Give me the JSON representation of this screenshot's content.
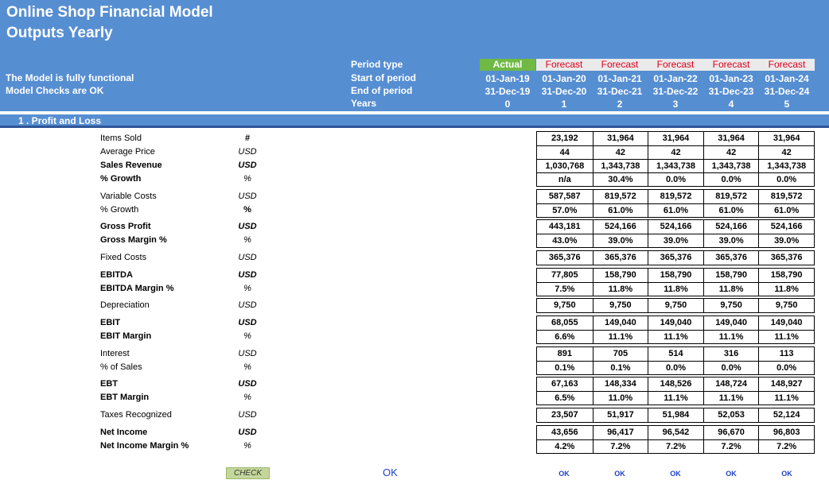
{
  "header": {
    "title_line1": "Online Shop Financial Model",
    "title_line2": "Outputs Yearly",
    "status_functional": "The Model is fully functional",
    "status_checks": "Model Checks are OK",
    "label_period_type": "Period type",
    "label_start": "Start of period",
    "label_end": "End of period",
    "label_years": "Years"
  },
  "columns": [
    {
      "type": "Actual",
      "start": "01-Jan-19",
      "end": "31-Dec-19",
      "year": "0"
    },
    {
      "type": "Forecast",
      "start": "01-Jan-20",
      "end": "31-Dec-20",
      "year": "1"
    },
    {
      "type": "Forecast",
      "start": "01-Jan-21",
      "end": "31-Dec-21",
      "year": "2"
    },
    {
      "type": "Forecast",
      "start": "01-Jan-22",
      "end": "31-Dec-22",
      "year": "3"
    },
    {
      "type": "Forecast",
      "start": "01-Jan-23",
      "end": "31-Dec-23",
      "year": "4"
    },
    {
      "type": "Forecast",
      "start": "01-Jan-24",
      "end": "31-Dec-24",
      "year": "5"
    }
  ],
  "section": {
    "title": "1 . Profit and Loss"
  },
  "rows": [
    {
      "label": "Items Sold",
      "unit": "#",
      "values": [
        "23,192",
        "31,964",
        "31,964",
        "31,964",
        "31,964"
      ]
    },
    {
      "label": "Average Price",
      "unit": "USD",
      "values": [
        "44",
        "42",
        "42",
        "42",
        "42"
      ]
    },
    {
      "label": "Sales Revenue",
      "unit": "USD",
      "values": [
        "1,030,768",
        "1,343,738",
        "1,343,738",
        "1,343,738",
        "1,343,738"
      ]
    },
    {
      "label": "% Growth",
      "unit": "%",
      "values": [
        "n/a",
        "30.4%",
        "0.0%",
        "0.0%",
        "0.0%"
      ]
    },
    {
      "label": "Variable Costs",
      "unit": "USD",
      "values": [
        "587,587",
        "819,572",
        "819,572",
        "819,572",
        "819,572"
      ]
    },
    {
      "label": "% Growth",
      "unit": "%",
      "values": [
        "57.0%",
        "61.0%",
        "61.0%",
        "61.0%",
        "61.0%"
      ]
    },
    {
      "label": "Gross Profit",
      "unit": "USD",
      "values": [
        "443,181",
        "524,166",
        "524,166",
        "524,166",
        "524,166"
      ]
    },
    {
      "label": "Gross Margin %",
      "unit": "%",
      "values": [
        "43.0%",
        "39.0%",
        "39.0%",
        "39.0%",
        "39.0%"
      ]
    },
    {
      "label": "Fixed Costs",
      "unit": "USD",
      "values": [
        "365,376",
        "365,376",
        "365,376",
        "365,376",
        "365,376"
      ]
    },
    {
      "label": "EBITDA",
      "unit": "USD",
      "values": [
        "77,805",
        "158,790",
        "158,790",
        "158,790",
        "158,790"
      ]
    },
    {
      "label": "EBITDA Margin %",
      "unit": "%",
      "values": [
        "7.5%",
        "11.8%",
        "11.8%",
        "11.8%",
        "11.8%"
      ]
    },
    {
      "label": "Depreciation",
      "unit": "USD",
      "values": [
        "9,750",
        "9,750",
        "9,750",
        "9,750",
        "9,750"
      ]
    },
    {
      "label": "EBIT",
      "unit": "USD",
      "values": [
        "68,055",
        "149,040",
        "149,040",
        "149,040",
        "149,040"
      ]
    },
    {
      "label": "EBIT Margin",
      "unit": "%",
      "values": [
        "6.6%",
        "11.1%",
        "11.1%",
        "11.1%",
        "11.1%"
      ]
    },
    {
      "label": "Interest",
      "unit": "USD",
      "values": [
        "891",
        "705",
        "514",
        "316",
        "113"
      ]
    },
    {
      "label": "% of Sales",
      "unit": "%",
      "values": [
        "0.1%",
        "0.1%",
        "0.0%",
        "0.0%",
        "0.0%"
      ]
    },
    {
      "label": "EBT",
      "unit": "USD",
      "values": [
        "67,163",
        "148,334",
        "148,526",
        "148,724",
        "148,927"
      ]
    },
    {
      "label": "EBT Margin",
      "unit": "%",
      "values": [
        "6.5%",
        "11.0%",
        "11.1%",
        "11.1%",
        "11.1%"
      ]
    },
    {
      "label": "Taxes Recognized",
      "unit": "USD",
      "values": [
        "23,507",
        "51,917",
        "51,984",
        "52,053",
        "52,124"
      ]
    },
    {
      "label": "Net Income",
      "unit": "USD",
      "values": [
        "43,656",
        "96,417",
        "96,542",
        "96,670",
        "96,803"
      ]
    },
    {
      "label": "Net Income Margin %",
      "unit": "%",
      "values": [
        "4.2%",
        "7.2%",
        "7.2%",
        "7.2%",
        "7.2%"
      ]
    }
  ],
  "footer": {
    "check_label": "CHECK",
    "ok_main": "OK",
    "ok_values": [
      "OK",
      "OK",
      "OK",
      "OK",
      "OK"
    ]
  },
  "colors": {
    "header_bg": "#568ed2",
    "actual_bg": "#6fb944",
    "forecast_bg": "#eaeaea",
    "forecast_text": "#e0001b",
    "ok_text": "#1f3fc8",
    "check_bg": "#c4d79b"
  }
}
